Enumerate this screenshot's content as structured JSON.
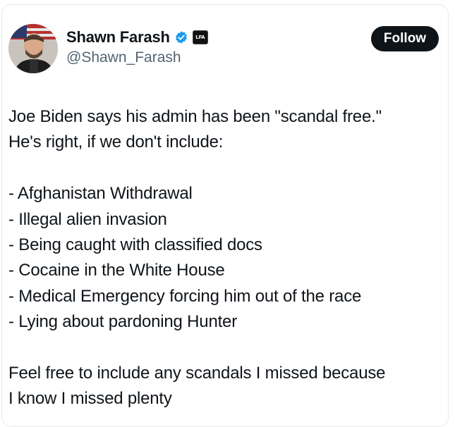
{
  "author": {
    "display_name": "Shawn Farash",
    "handle": "@Shawn_Farash",
    "verified_icon": "verified-badge-blue",
    "affiliate_badge_text": "LFA",
    "verified_color": "#1d9bf0"
  },
  "follow_button": {
    "label": "Follow"
  },
  "tweet": {
    "intro_lines": [
      "Joe Biden says his admin has been \"scandal free.\"",
      "He's right, if we don't include:"
    ],
    "list_items": [
      "- Afghanistan Withdrawal",
      "- Illegal alien invasion",
      "- Being caught with classified docs",
      "- Cocaine in the White House",
      "- Medical Emergency forcing him out of the race",
      "- Lying about pardoning Hunter"
    ],
    "outro_lines": [
      "Feel free to include any scandals I missed because",
      "I know I missed plenty"
    ]
  }
}
